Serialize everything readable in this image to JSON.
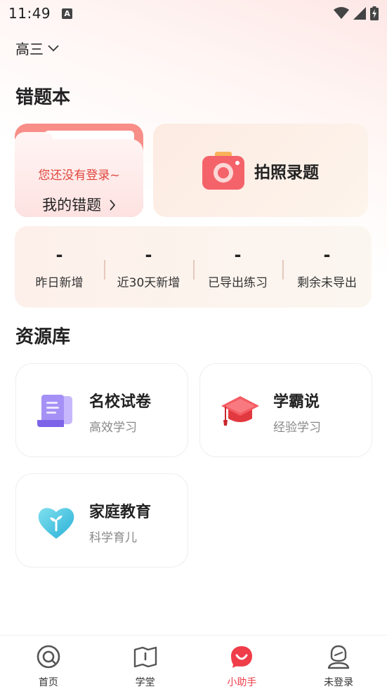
{
  "status": {
    "time": "11:49",
    "notification": "A"
  },
  "header": {
    "grade": "高三"
  },
  "wrong_book": {
    "title": "错题本",
    "login_hint": "您还没有登录~",
    "my_wrong_label": "我的错题",
    "photo_label": "拍照录题",
    "stats": [
      {
        "value": "-",
        "label": "昨日新增"
      },
      {
        "value": "-",
        "label": "近30天新增"
      },
      {
        "value": "-",
        "label": "已导出练习"
      },
      {
        "value": "-",
        "label": "剩余未导出"
      }
    ]
  },
  "resources": {
    "title": "资源库",
    "items": [
      {
        "title": "名校试卷",
        "subtitle": "高效学习",
        "icon": "exam-paper-icon"
      },
      {
        "title": "学霸说",
        "subtitle": "经验学习",
        "icon": "graduation-cap-icon"
      },
      {
        "title": "家庭教育",
        "subtitle": "科学育儿",
        "icon": "heart-sprout-icon"
      }
    ]
  },
  "nav": {
    "items": [
      {
        "label": "首页",
        "icon": "home-icon"
      },
      {
        "label": "学堂",
        "icon": "book-icon"
      },
      {
        "label": "小助手",
        "icon": "assistant-icon",
        "active": true
      },
      {
        "label": "未登录",
        "icon": "user-icon"
      }
    ]
  },
  "colors": {
    "accent": "#ef3d4a",
    "hint": "#e0463d",
    "subtext": "#888888"
  }
}
